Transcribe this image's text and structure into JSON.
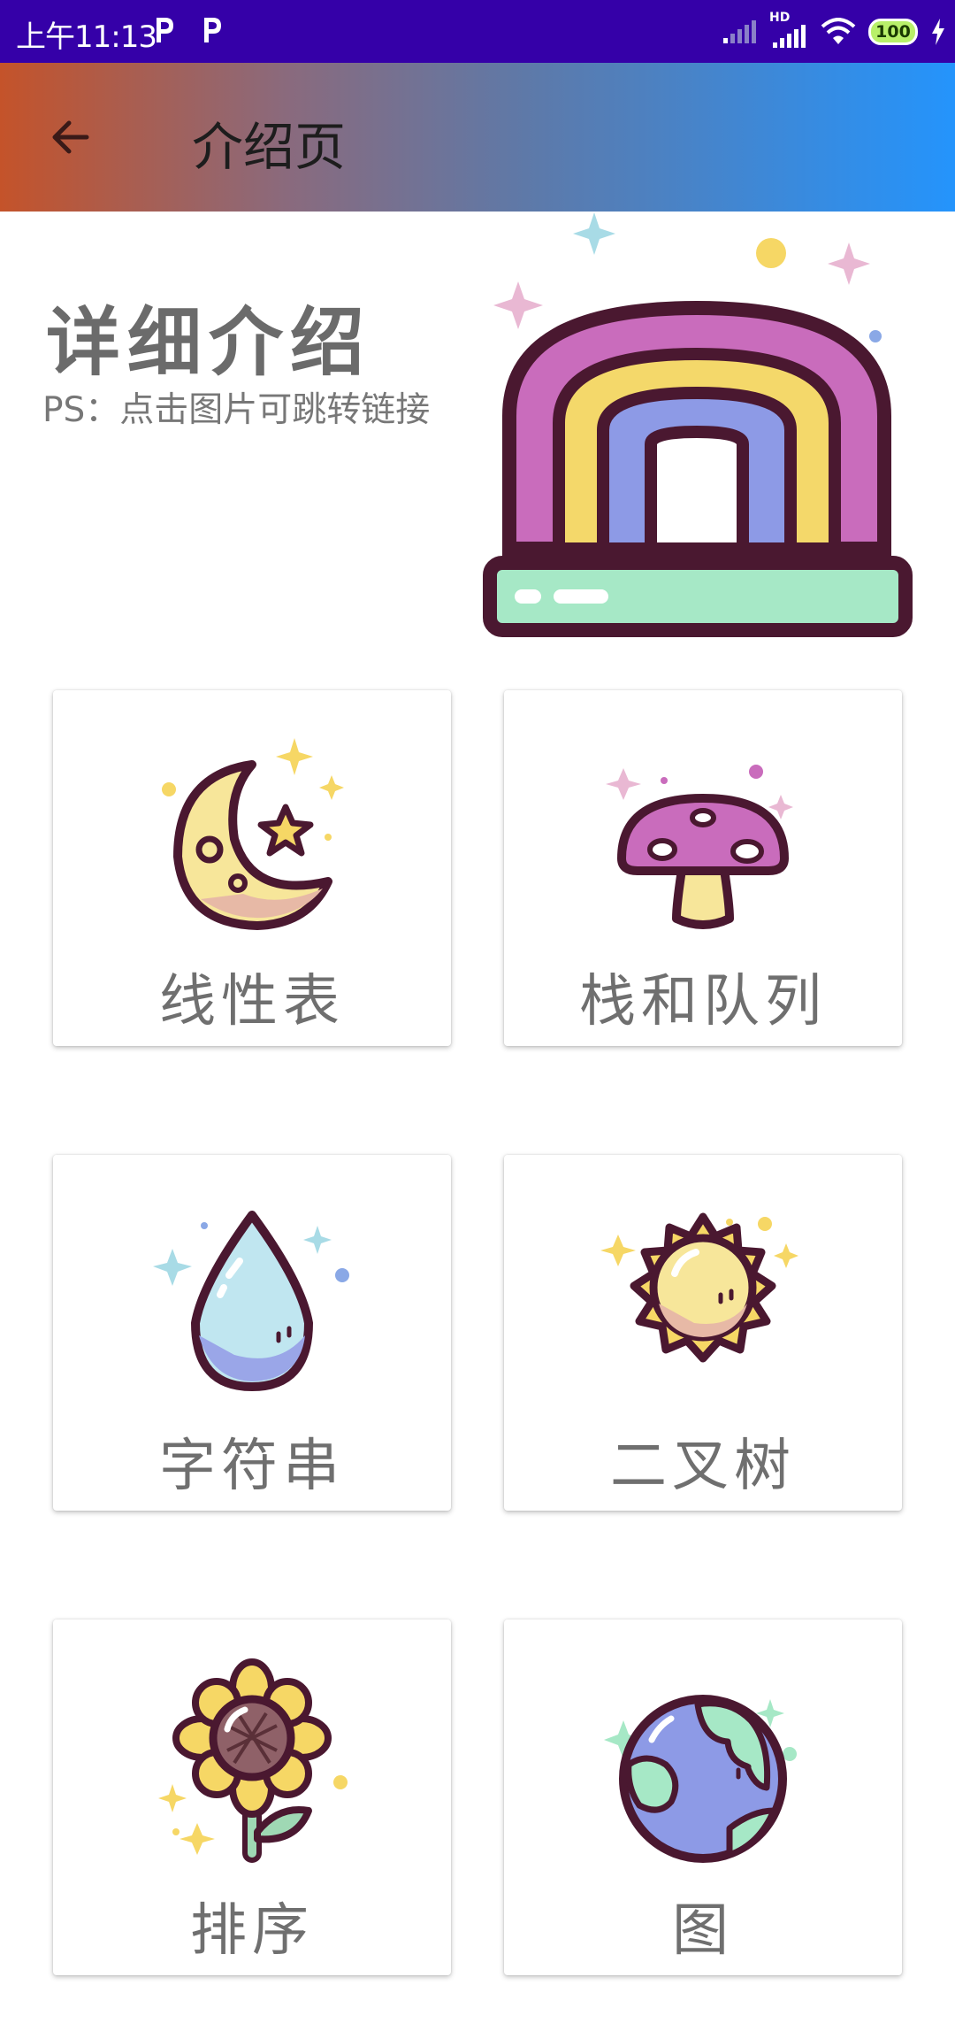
{
  "status_bar": {
    "time": "上午11:13",
    "network": "HD",
    "battery": "100"
  },
  "app_bar": {
    "title": "介绍页"
  },
  "intro": {
    "title": "详细介绍",
    "subtitle": "PS：点击图片可跳转链接"
  },
  "cards": [
    {
      "label": "线性表",
      "icon": "moon-icon"
    },
    {
      "label": "栈和队列",
      "icon": "mushroom-icon"
    },
    {
      "label": "字符串",
      "icon": "water-drop-icon"
    },
    {
      "label": "二叉树",
      "icon": "sun-icon"
    },
    {
      "label": "排序",
      "icon": "sunflower-icon"
    },
    {
      "label": "图",
      "icon": "globe-icon"
    }
  ],
  "colors": {
    "status_bar": "#3500a8",
    "app_bar_start": "#c4532a",
    "app_bar_end": "#2494fc",
    "outline": "#4a1830"
  }
}
